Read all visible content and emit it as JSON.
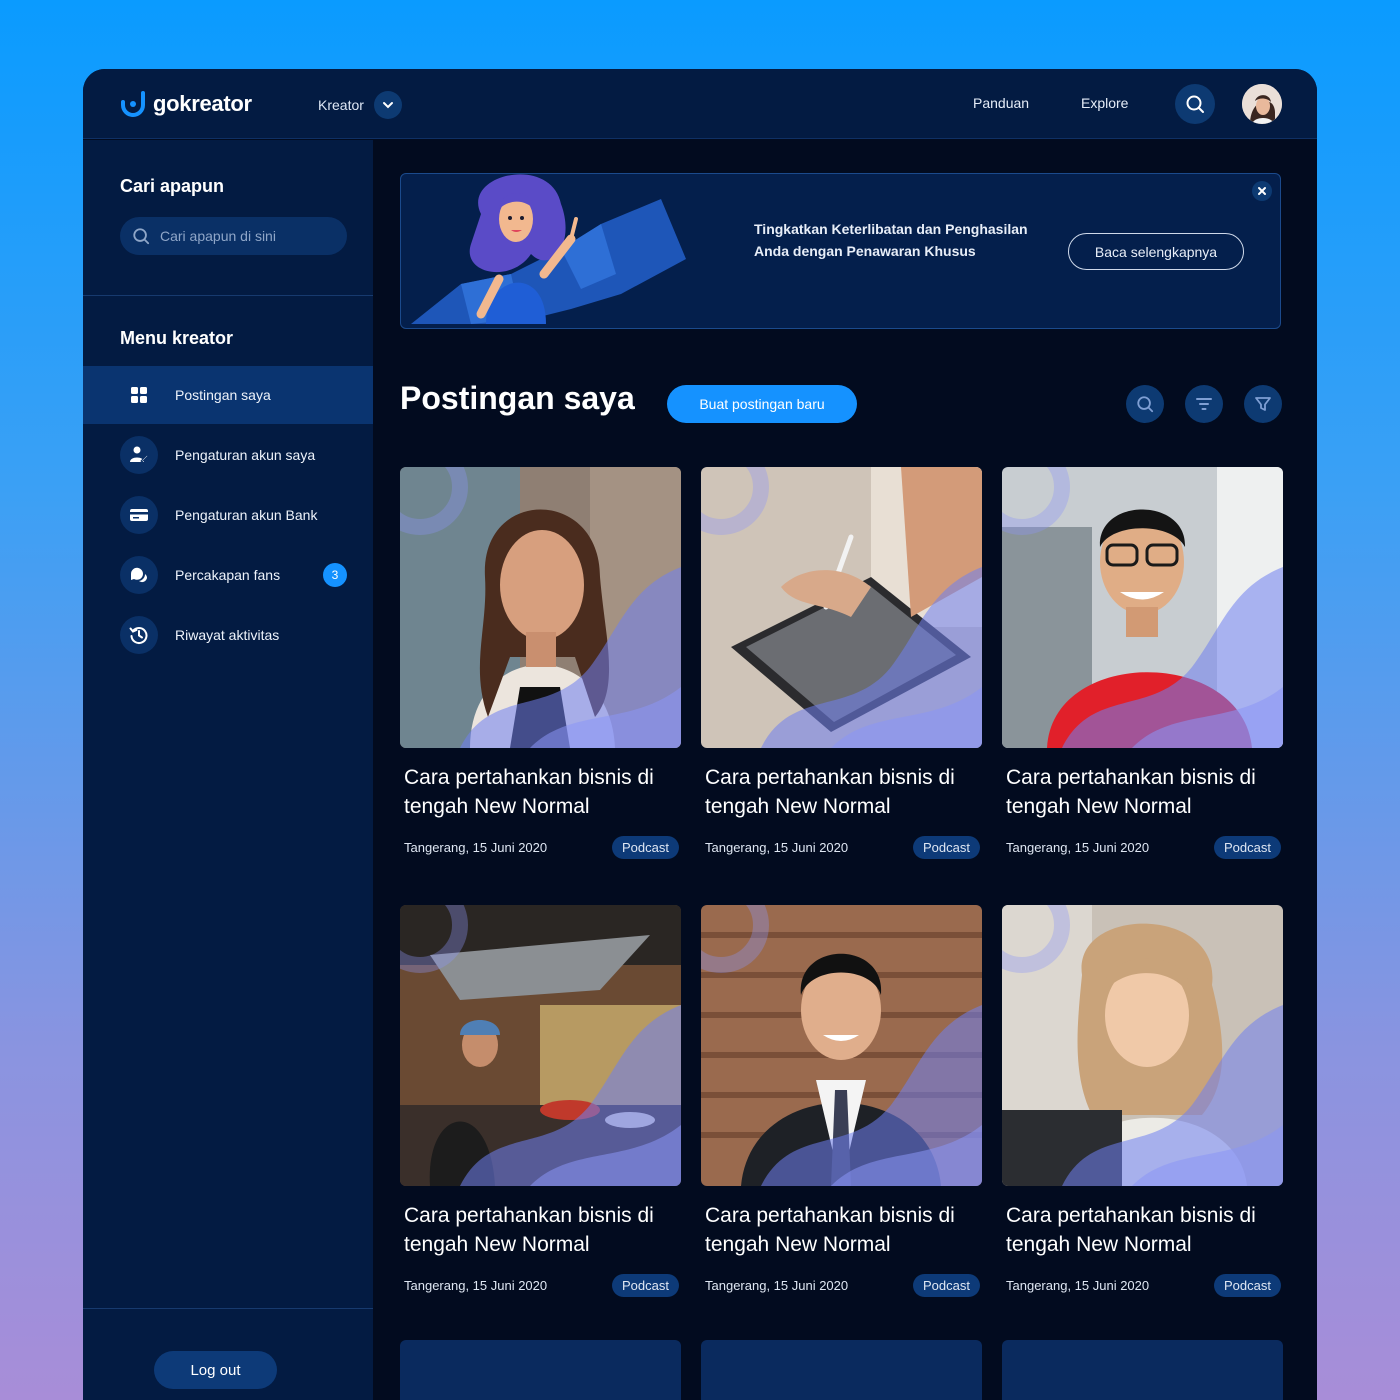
{
  "topbar": {
    "logo": "gokreator",
    "role_menu": "Kreator",
    "nav": [
      "Panduan",
      "Explore"
    ]
  },
  "sidebar": {
    "search_heading": "Cari apapun",
    "search_placeholder": "Cari apapun di sini",
    "menu_heading": "Menu kreator",
    "items": [
      {
        "label": "Postingan saya",
        "icon": "grid-icon"
      },
      {
        "label": "Pengaturan akun saya",
        "icon": "user-edit-icon"
      },
      {
        "label": "Pengaturan akun Bank",
        "icon": "bank-card-icon"
      },
      {
        "label": "Percakapan fans",
        "icon": "chat-icon",
        "badge": "3"
      },
      {
        "label": "Riwayat aktivitas",
        "icon": "history-icon"
      }
    ],
    "logout": "Log out"
  },
  "banner": {
    "text": "Tingkatkan Keterlibatan dan Penghasilan Anda dengan Penawaran Khusus",
    "button": "Baca selengkapnya"
  },
  "main": {
    "title": "Postingan saya",
    "new_post_button": "Buat postingan baru"
  },
  "posts": [
    {
      "title": "Cara pertahankan bisnis di tengah New Normal",
      "meta": "Tangerang, 15 Juni 2020",
      "tag": "Podcast",
      "photo": "woman-portrait"
    },
    {
      "title": "Cara pertahankan bisnis di tengah New Normal",
      "meta": "Tangerang, 15 Juni 2020",
      "tag": "Podcast",
      "photo": "tablet-stylus"
    },
    {
      "title": "Cara pertahankan bisnis di tengah New Normal",
      "meta": "Tangerang, 15 Juni 2020",
      "tag": "Podcast",
      "photo": "man-red-shirt"
    },
    {
      "title": "Cara pertahankan bisnis di tengah New Normal",
      "meta": "Tangerang, 15 Juni 2020",
      "tag": "Podcast",
      "photo": "kitchen-cook"
    },
    {
      "title": "Cara pertahankan bisnis di tengah New Normal",
      "meta": "Tangerang, 15 Juni 2020",
      "tag": "Podcast",
      "photo": "man-suit"
    },
    {
      "title": "Cara pertahankan bisnis di tengah New Normal",
      "meta": "Tangerang, 15 Juni 2020",
      "tag": "Podcast",
      "photo": "woman-laptop"
    }
  ],
  "colors": {
    "accent": "#1592ff",
    "panel": "#031b42",
    "background": "#020b1f"
  }
}
